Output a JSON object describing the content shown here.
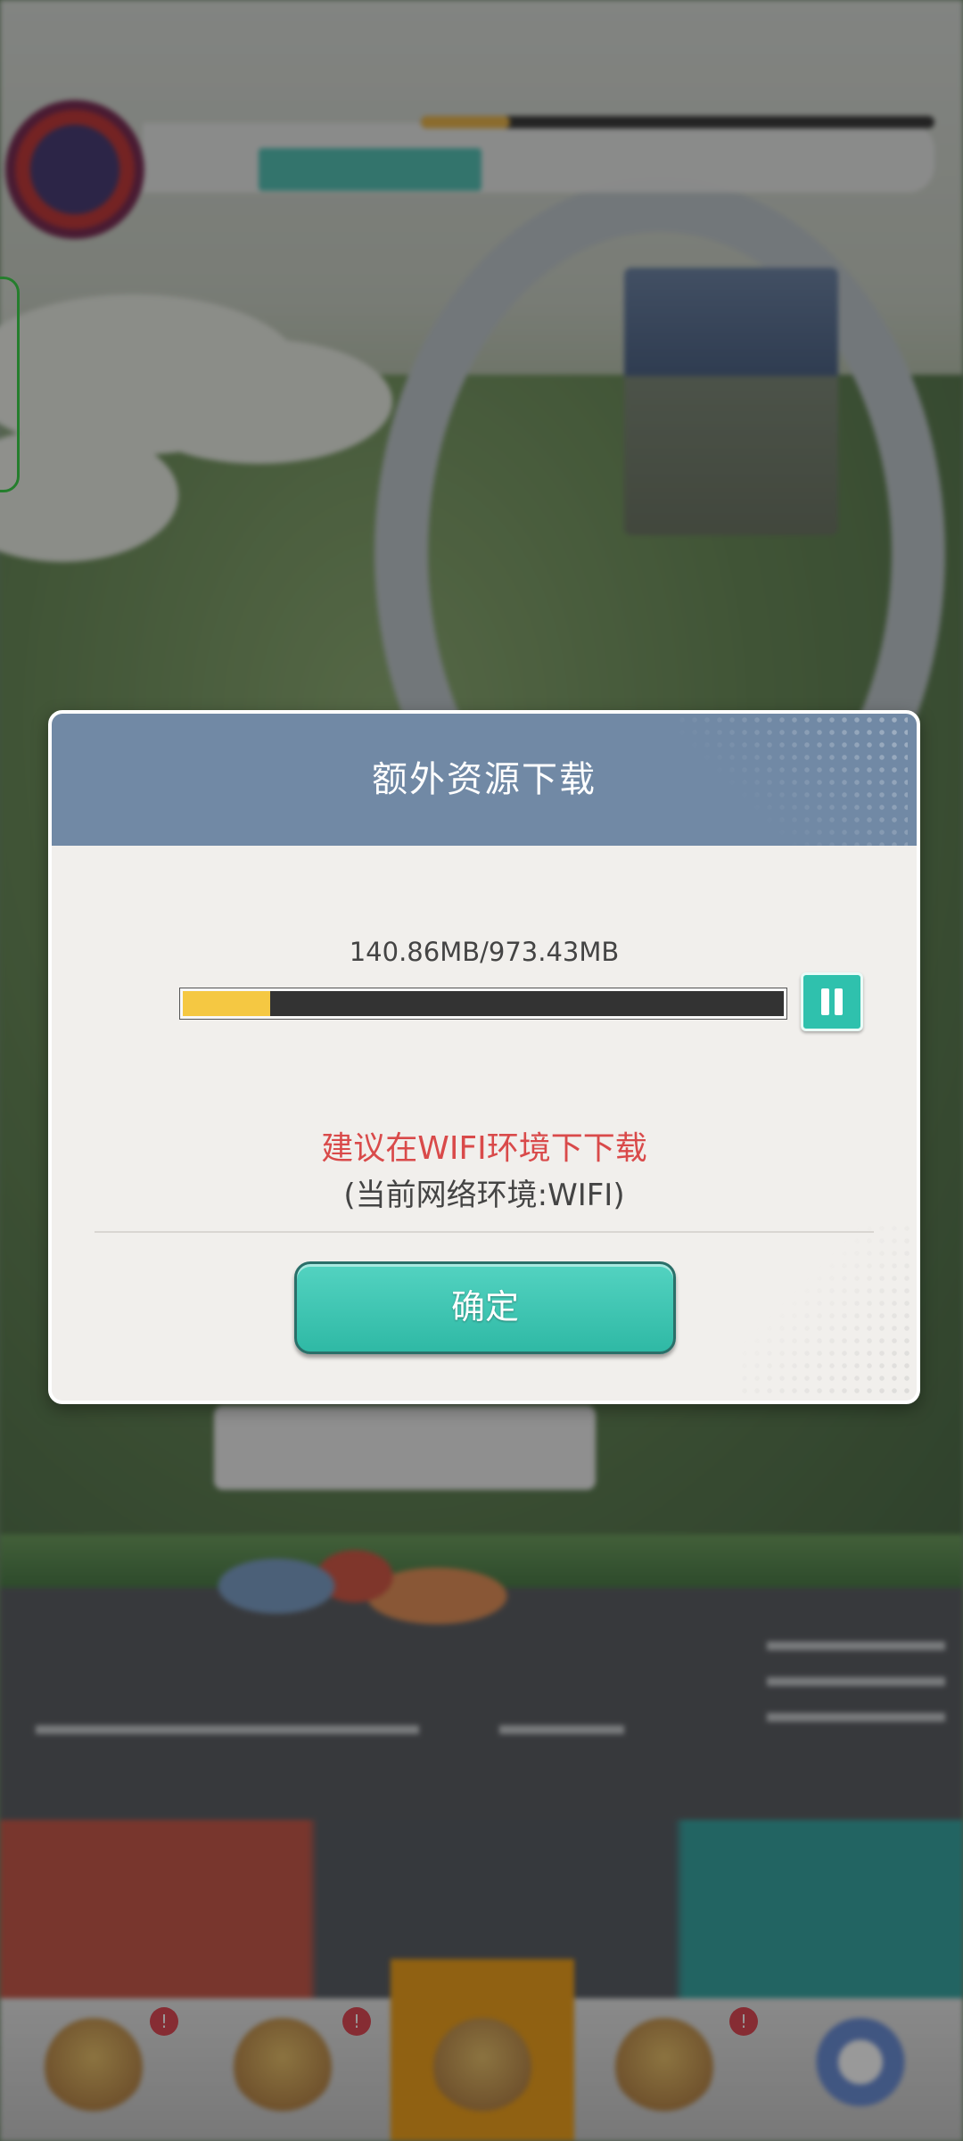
{
  "dialog": {
    "title": "额外资源下载",
    "progress_text": "140.86MB/973.43MB",
    "downloaded_mb": 140.86,
    "total_mb": 973.43,
    "warning": "建议在WIFI环境下下载",
    "network_status": "(当前网络环境:WIFI)",
    "confirm_label": "确定",
    "pause_icon": "pause-icon"
  },
  "colors": {
    "header": "#7189a5",
    "progress_fill": "#f5c842",
    "warning_text": "#d94a4a",
    "button": "#2fc1ad"
  },
  "background": {
    "speech_bubble": "",
    "notification_badges": [
      "!",
      "!",
      "!"
    ]
  }
}
